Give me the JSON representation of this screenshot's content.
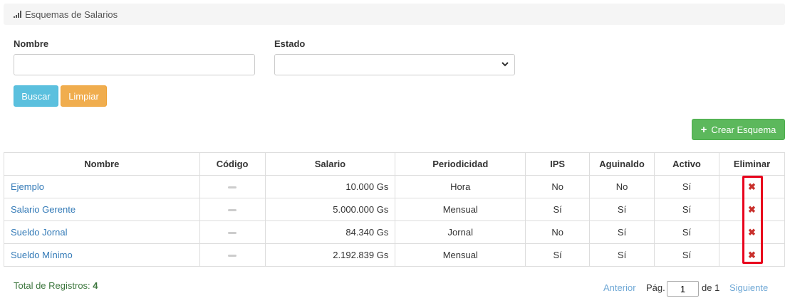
{
  "header": {
    "title": "Esquemas de Salarios",
    "icon": "signal-icon"
  },
  "filters": {
    "nombre_label": "Nombre",
    "nombre_value": "",
    "estado_label": "Estado",
    "estado_value": ""
  },
  "buttons": {
    "buscar": "Buscar",
    "limpiar": "Limpiar",
    "crear": "Crear Esquema"
  },
  "table": {
    "headers": [
      "Nombre",
      "Código",
      "Salario",
      "Periodicidad",
      "IPS",
      "Aguinaldo",
      "Activo",
      "Eliminar"
    ],
    "rows": [
      {
        "nombre": "Ejemplo",
        "salario": "10.000 Gs",
        "periodicidad": "Hora",
        "ips": "No",
        "aguinaldo": "No",
        "activo": "Sí"
      },
      {
        "nombre": "Salario Gerente",
        "salario": "5.000.000 Gs",
        "periodicidad": "Mensual",
        "ips": "Sí",
        "aguinaldo": "Sí",
        "activo": "Sí"
      },
      {
        "nombre": "Sueldo Jornal",
        "salario": "84.340 Gs",
        "periodicidad": "Jornal",
        "ips": "No",
        "aguinaldo": "Sí",
        "activo": "Sí"
      },
      {
        "nombre": "Sueldo Mínimo",
        "salario": "2.192.839 Gs",
        "periodicidad": "Mensual",
        "ips": "Sí",
        "aguinaldo": "Sí",
        "activo": "Sí"
      }
    ]
  },
  "footer": {
    "total_label": "Total de Registros:",
    "total_value": "4",
    "anterior": "Anterior",
    "pag_label": "Pág.",
    "page_value": "1",
    "de_label": "de 1",
    "siguiente": "Siguiente"
  },
  "colors": {
    "link": "#337ab7",
    "info": "#5bc0de",
    "warning": "#f0ad4e",
    "success": "#5cb85c",
    "delete": "#c9302c",
    "highlight": "#e8001c"
  }
}
